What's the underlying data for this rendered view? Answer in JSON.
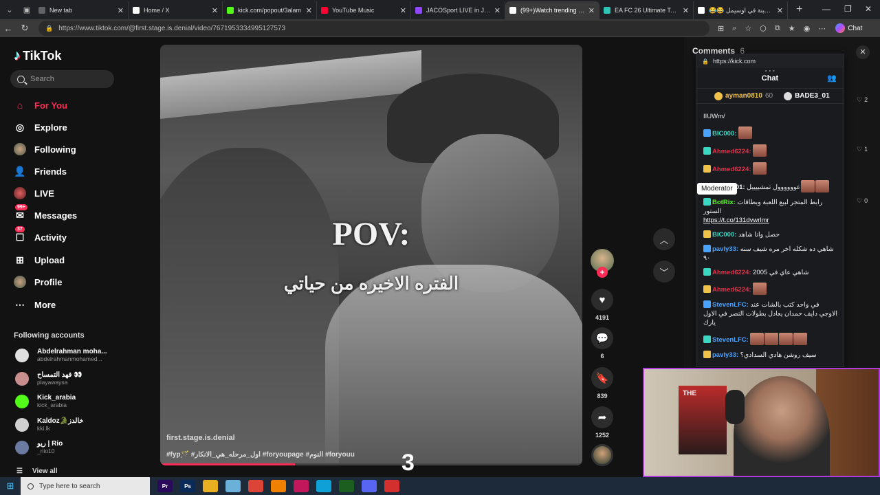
{
  "browser": {
    "tabs": [
      {
        "title": "New tab",
        "color": "#5f6368",
        "active": false
      },
      {
        "title": "Home / X",
        "color": "#ffffff",
        "active": false
      },
      {
        "title": "kick.com/popout/3alam",
        "color": "#53fc18",
        "active": false
      },
      {
        "title": "YouTube Music",
        "color": "#ff0033",
        "active": false
      },
      {
        "title": "JACOSport LIVE in JACO - J",
        "color": "#9146ff",
        "active": false
      },
      {
        "title": "(99+)Watch trending video",
        "color": "#ffffff",
        "active": true
      },
      {
        "title": "EA FC 26 Ultimate Team Pr",
        "color": "#2ec4b6",
        "active": false
      },
      {
        "title": "😂😂 نكتة الجبنة في اوسيمل",
        "color": "#ffffff",
        "active": false
      }
    ],
    "url": "https://www.tiktok.com/@first.stage.is.denial/video/7671953334995127573",
    "chat_label": "Chat"
  },
  "sidebar": {
    "logo": "TikTok",
    "search_placeholder": "Search",
    "nav": [
      {
        "label": "For You",
        "icon": "home-icon",
        "active": true
      },
      {
        "label": "Explore",
        "icon": "compass-icon",
        "active": false
      },
      {
        "label": "Following",
        "icon": "following-avatar-icon",
        "active": false
      },
      {
        "label": "Friends",
        "icon": "friends-icon",
        "active": false
      },
      {
        "label": "LIVE",
        "icon": "live-icon",
        "active": false
      },
      {
        "label": "Messages",
        "icon": "messages-icon",
        "badge": "99+",
        "active": false
      },
      {
        "label": "Activity",
        "icon": "activity-icon",
        "badge": "37",
        "active": false
      },
      {
        "label": "Upload",
        "icon": "upload-icon",
        "active": false
      },
      {
        "label": "Profile",
        "icon": "profile-avatar-icon",
        "active": false
      },
      {
        "label": "More",
        "icon": "more-icon",
        "active": false
      }
    ],
    "following_title": "Following accounts",
    "following": [
      {
        "name": "Abdelrahman moha...",
        "handle": "abdelrahmanmohamed...",
        "color": "#e0e0e0"
      },
      {
        "name": "فهد التمساح 👀",
        "handle": "playawaysa",
        "color": "#c98f8f"
      },
      {
        "name": "Kick_arabia",
        "handle": "kick_arabia",
        "color": "#53fc18"
      },
      {
        "name": "Kaldoz🐊خالدز",
        "handle": "kki.lk",
        "color": "#d0d0d0"
      },
      {
        "name": "ريو | Rio",
        "handle": "_riio10",
        "color": "#6a7aa0"
      }
    ],
    "view_all": "View all"
  },
  "video": {
    "pov": "POV:",
    "subtitle": "الفتره الاخيره من حياتي",
    "author": "first.stage.is.denial",
    "caption": "#fyp🪄 #اول_مرحله_هي_الانكار #foryoupage #النوم #foryouu",
    "progress": 0.32,
    "overlay_number": "3"
  },
  "actions": {
    "likes": "4191",
    "comments": "6",
    "saves": "839",
    "shares": "1252"
  },
  "comments_panel": {
    "title": "Comments",
    "count": "6",
    "likes": [
      "2",
      "1",
      "0"
    ]
  },
  "kick_chat": {
    "url": "https://kick.com",
    "title": "Chat",
    "pinned": [
      {
        "user": "ayman0810",
        "amount": "60"
      },
      {
        "user": "BADE3_01",
        "amount": ""
      }
    ],
    "moderator_tooltip": "Moderator",
    "messages": [
      {
        "user": "",
        "color": "#ffffff",
        "text": "IIUWm/",
        "emotes": 0
      },
      {
        "user": "BIC000:",
        "color": "#3ad7c2",
        "text": "",
        "emotes": 1
      },
      {
        "user": "Ahmed6224:",
        "color": "#e0314a",
        "text": "",
        "emotes": 1
      },
      {
        "user": "Ahmed6224:",
        "color": "#e0314a",
        "text": "",
        "emotes": 1
      },
      {
        "user": "3thman01:",
        "color": "#ffffff",
        "text": "عوووووول تمشييييل",
        "emotes": 2
      },
      {
        "user": "BotRix:",
        "color": "#53fc18",
        "text": "رابط المتجر لبيع اللعبة وبطاقات الستور",
        "link": "https://t.co/131dvwrlmr",
        "emotes": 0
      },
      {
        "user": "BIC000:",
        "color": "#3ad7c2",
        "text": "حصل وانا شاهد",
        "emotes": 0
      },
      {
        "user": "pavly33:",
        "color": "#4aa3ff",
        "text": "شاهي ده شكله اخر مره شيف سنه ٩٠",
        "emotes": 0
      },
      {
        "user": "Ahmed6224:",
        "color": "#e0314a",
        "text": "شاهي عاي في 2005",
        "emotes": 0
      },
      {
        "user": "Ahmed6224:",
        "color": "#e0314a",
        "text": "",
        "emotes": 1
      },
      {
        "user": "StevenLFC:",
        "color": "#4aa3ff",
        "text": "في واحد كتب بالشات عند الاوجي دايف حمدان يعادل بطولات النصر في الاول يارك",
        "emotes": 0
      },
      {
        "user": "StevenLFC:",
        "color": "#4aa3ff",
        "text": "",
        "emotes": 4
      },
      {
        "user": "pavly33:",
        "color": "#4aa3ff",
        "text": "سيف روشن هادي السدادي؟",
        "emotes": 0
      }
    ]
  },
  "webcam": {
    "poster_text": "THE"
  },
  "taskbar": {
    "search_placeholder": "Type here to search",
    "apps": [
      {
        "name": "premiere-icon",
        "label": "Pr",
        "color": "#2a0a5a"
      },
      {
        "name": "photoshop-icon",
        "label": "Ps",
        "color": "#0a2a5a"
      },
      {
        "name": "explorer-icon",
        "label": "",
        "color": "#e8b021"
      },
      {
        "name": "notepad-icon",
        "label": "",
        "color": "#6ab0d8"
      },
      {
        "name": "chrome-icon",
        "label": "",
        "color": "#db4437"
      },
      {
        "name": "vlc-icon",
        "label": "",
        "color": "#f08000"
      },
      {
        "name": "winrar-icon",
        "label": "",
        "color": "#c2185b"
      },
      {
        "name": "edge-icon",
        "label": "",
        "color": "#0fa0d8"
      },
      {
        "name": "kick-app-icon",
        "label": "",
        "color": "#1b5e20"
      },
      {
        "name": "discord-icon",
        "label": "",
        "color": "#5865f2"
      },
      {
        "name": "obs-icon",
        "label": "",
        "color": "#d32f2f"
      }
    ]
  }
}
